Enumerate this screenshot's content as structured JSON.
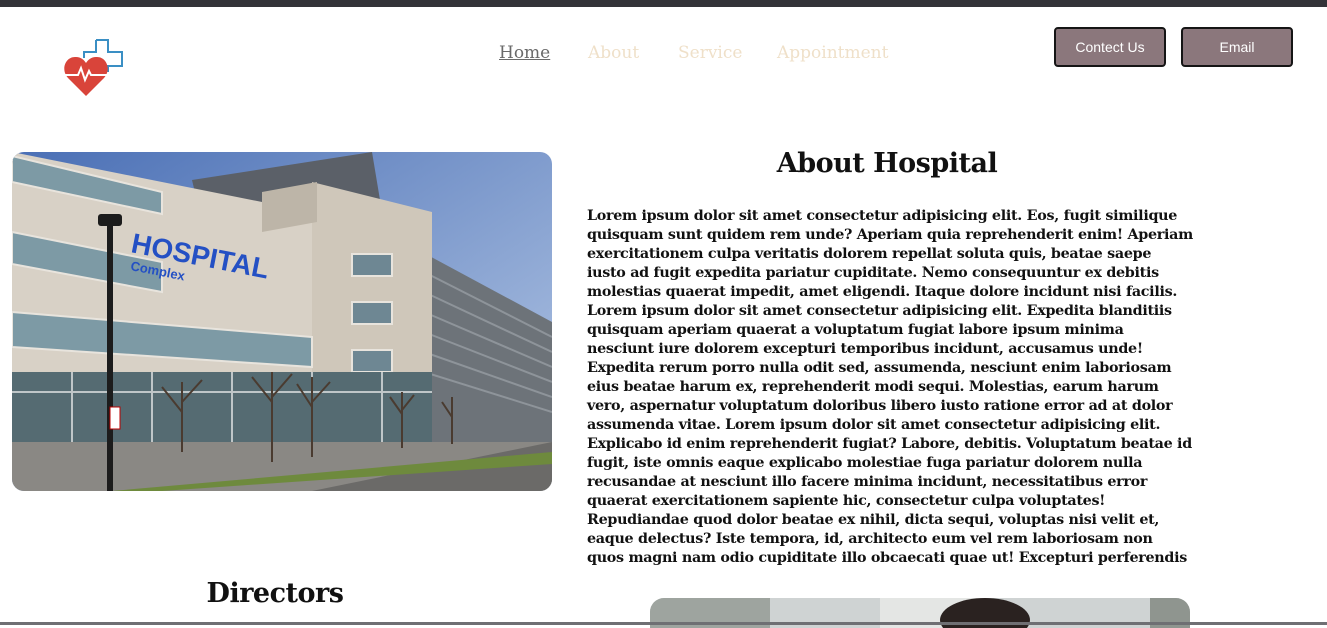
{
  "nav": {
    "home": "Home",
    "about": "About",
    "service": "Service",
    "appointment": "Appointment"
  },
  "header": {
    "contact_label": "Contect Us",
    "email_label": "Email"
  },
  "hero": {
    "sign_text": "HOSPITAL",
    "sign_subtext": "Complex"
  },
  "about": {
    "title": "About Hospital",
    "body": "Lorem ipsum dolor sit amet consectetur adipisicing elit. Eos, fugit similique quisquam sunt quidem rem unde? Aperiam quia reprehenderit enim! Aperiam exercitationem culpa veritatis dolorem repellat soluta quis, beatae saepe iusto ad fugit expedita pariatur cupiditate. Nemo consequuntur ex debitis molestias quaerat impedit, amet eligendi. Itaque dolore incidunt nisi facilis. Lorem ipsum dolor sit amet consectetur adipisicing elit. Expedita blanditiis quisquam aperiam quaerat a voluptatum fugiat labore ipsum minima nesciunt iure dolorem excepturi temporibus incidunt, accusamus unde! Expedita rerum porro nulla odit sed, assumenda, nesciunt enim laboriosam eius beatae harum ex, reprehenderit modi sequi. Molestias, earum harum vero, aspernatur voluptatum doloribus libero iusto ratione error ad at dolor assumenda vitae. Lorem ipsum dolor sit amet consectetur adipisicing elit. Explicabo id enim reprehenderit fugiat? Labore, debitis. Voluptatum beatae id fugit, iste omnis eaque explicabo molestiae fuga pariatur dolorem nulla recusandae at nesciunt illo facere minima incidunt, necessitatibus error quaerat exercitationem sapiente hic, consectetur culpa voluptates! Repudiandae quod dolor beatae ex nihil, dicta sequi, voluptas nisi velit et, eaque delectus? Iste tempora, id, architecto eum vel rem laboriosam non quos magni nam odio cupiditate illo obcaecati quae ut! Excepturi perferendis"
  },
  "directors": {
    "title": "Directors"
  },
  "colors": {
    "button_bg": "#8b777c",
    "nav_inactive": "#efe0c9",
    "nav_active": "#6a6a6a",
    "logo_heart": "#d9443a",
    "logo_cross": "#3a8fc4"
  }
}
